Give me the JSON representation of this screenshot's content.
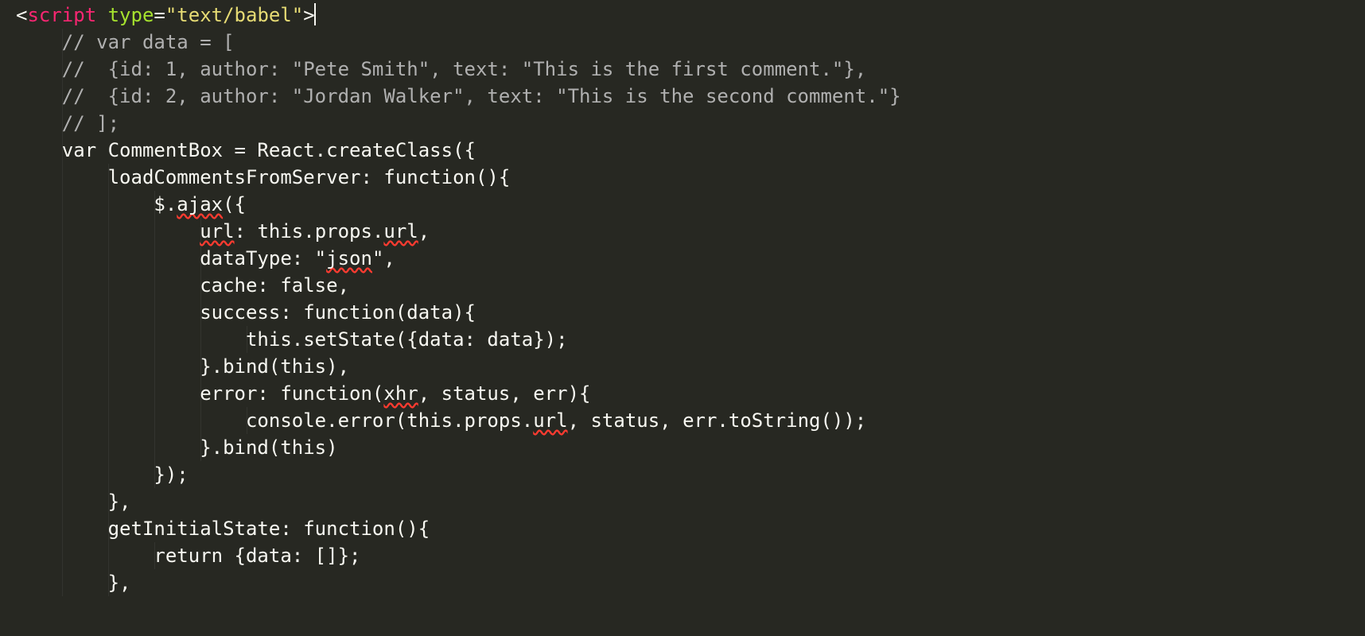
{
  "editor": {
    "indent_cols": [
      4,
      8,
      12,
      16,
      20
    ],
    "cursor_line": 0,
    "cursor_after_token": ">",
    "lines": [
      {
        "indent": 0,
        "tokens": [
          {
            "t": "<",
            "c": "white"
          },
          {
            "t": "script",
            "c": "red"
          },
          {
            "t": " ",
            "c": "white"
          },
          {
            "t": "type",
            "c": "green"
          },
          {
            "t": "=",
            "c": "white"
          },
          {
            "t": "\"text/babel\"",
            "c": "yellow"
          },
          {
            "t": ">",
            "c": "white"
          }
        ]
      },
      {
        "indent": 4,
        "tokens": [
          {
            "t": "// var data = [",
            "c": "comment"
          }
        ]
      },
      {
        "indent": 4,
        "tokens": [
          {
            "t": "//  {id: 1, author: \"Pete Smith\", text: \"This is the first comment.\"},",
            "c": "comment"
          }
        ]
      },
      {
        "indent": 4,
        "tokens": [
          {
            "t": "//  {id: 2, author: \"Jordan Walker\", text: \"This is the second comment.\"}",
            "c": "comment"
          }
        ]
      },
      {
        "indent": 4,
        "tokens": [
          {
            "t": "// ];",
            "c": "comment"
          }
        ]
      },
      {
        "indent": 4,
        "tokens": [
          {
            "t": "var CommentBox = React.createClass({",
            "c": "white"
          }
        ]
      },
      {
        "indent": 8,
        "tokens": [
          {
            "t": "loadCommentsFromServer: function(){",
            "c": "white"
          }
        ]
      },
      {
        "indent": 12,
        "tokens": [
          {
            "t": "$.",
            "c": "white"
          },
          {
            "t": "ajax",
            "c": "white",
            "spell": true
          },
          {
            "t": "({",
            "c": "white"
          }
        ]
      },
      {
        "indent": 16,
        "tokens": [
          {
            "t": "url",
            "c": "white",
            "spell": true
          },
          {
            "t": ": this.props.",
            "c": "white"
          },
          {
            "t": "url",
            "c": "white",
            "spell": true
          },
          {
            "t": ",",
            "c": "white"
          }
        ]
      },
      {
        "indent": 16,
        "tokens": [
          {
            "t": "dataType: \"",
            "c": "white"
          },
          {
            "t": "json",
            "c": "white",
            "spell": true
          },
          {
            "t": "\",",
            "c": "white"
          }
        ]
      },
      {
        "indent": 16,
        "tokens": [
          {
            "t": "cache: false,",
            "c": "white"
          }
        ]
      },
      {
        "indent": 16,
        "tokens": [
          {
            "t": "success: function(data){",
            "c": "white"
          }
        ]
      },
      {
        "indent": 20,
        "tokens": [
          {
            "t": "this.setState({data: data});",
            "c": "white"
          }
        ]
      },
      {
        "indent": 16,
        "tokens": [
          {
            "t": "}.bind(this),",
            "c": "white"
          }
        ]
      },
      {
        "indent": 16,
        "tokens": [
          {
            "t": "error: function(",
            "c": "white"
          },
          {
            "t": "xhr",
            "c": "white",
            "spell": true
          },
          {
            "t": ", status, err){",
            "c": "white"
          }
        ]
      },
      {
        "indent": 20,
        "tokens": [
          {
            "t": "console.error(this.props.",
            "c": "white"
          },
          {
            "t": "url",
            "c": "white",
            "spell": true
          },
          {
            "t": ", status, err.toString());",
            "c": "white"
          }
        ]
      },
      {
        "indent": 16,
        "tokens": [
          {
            "t": "}.bind(this)",
            "c": "white"
          }
        ]
      },
      {
        "indent": 12,
        "tokens": [
          {
            "t": "});",
            "c": "white"
          }
        ]
      },
      {
        "indent": 8,
        "tokens": [
          {
            "t": "},",
            "c": "white"
          }
        ]
      },
      {
        "indent": 8,
        "tokens": [
          {
            "t": "getInitialState: function(){",
            "c": "white"
          }
        ]
      },
      {
        "indent": 12,
        "tokens": [
          {
            "t": "return {data: []};",
            "c": "white"
          }
        ]
      },
      {
        "indent": 8,
        "tokens": [
          {
            "t": "},",
            "c": "white"
          }
        ]
      }
    ]
  }
}
